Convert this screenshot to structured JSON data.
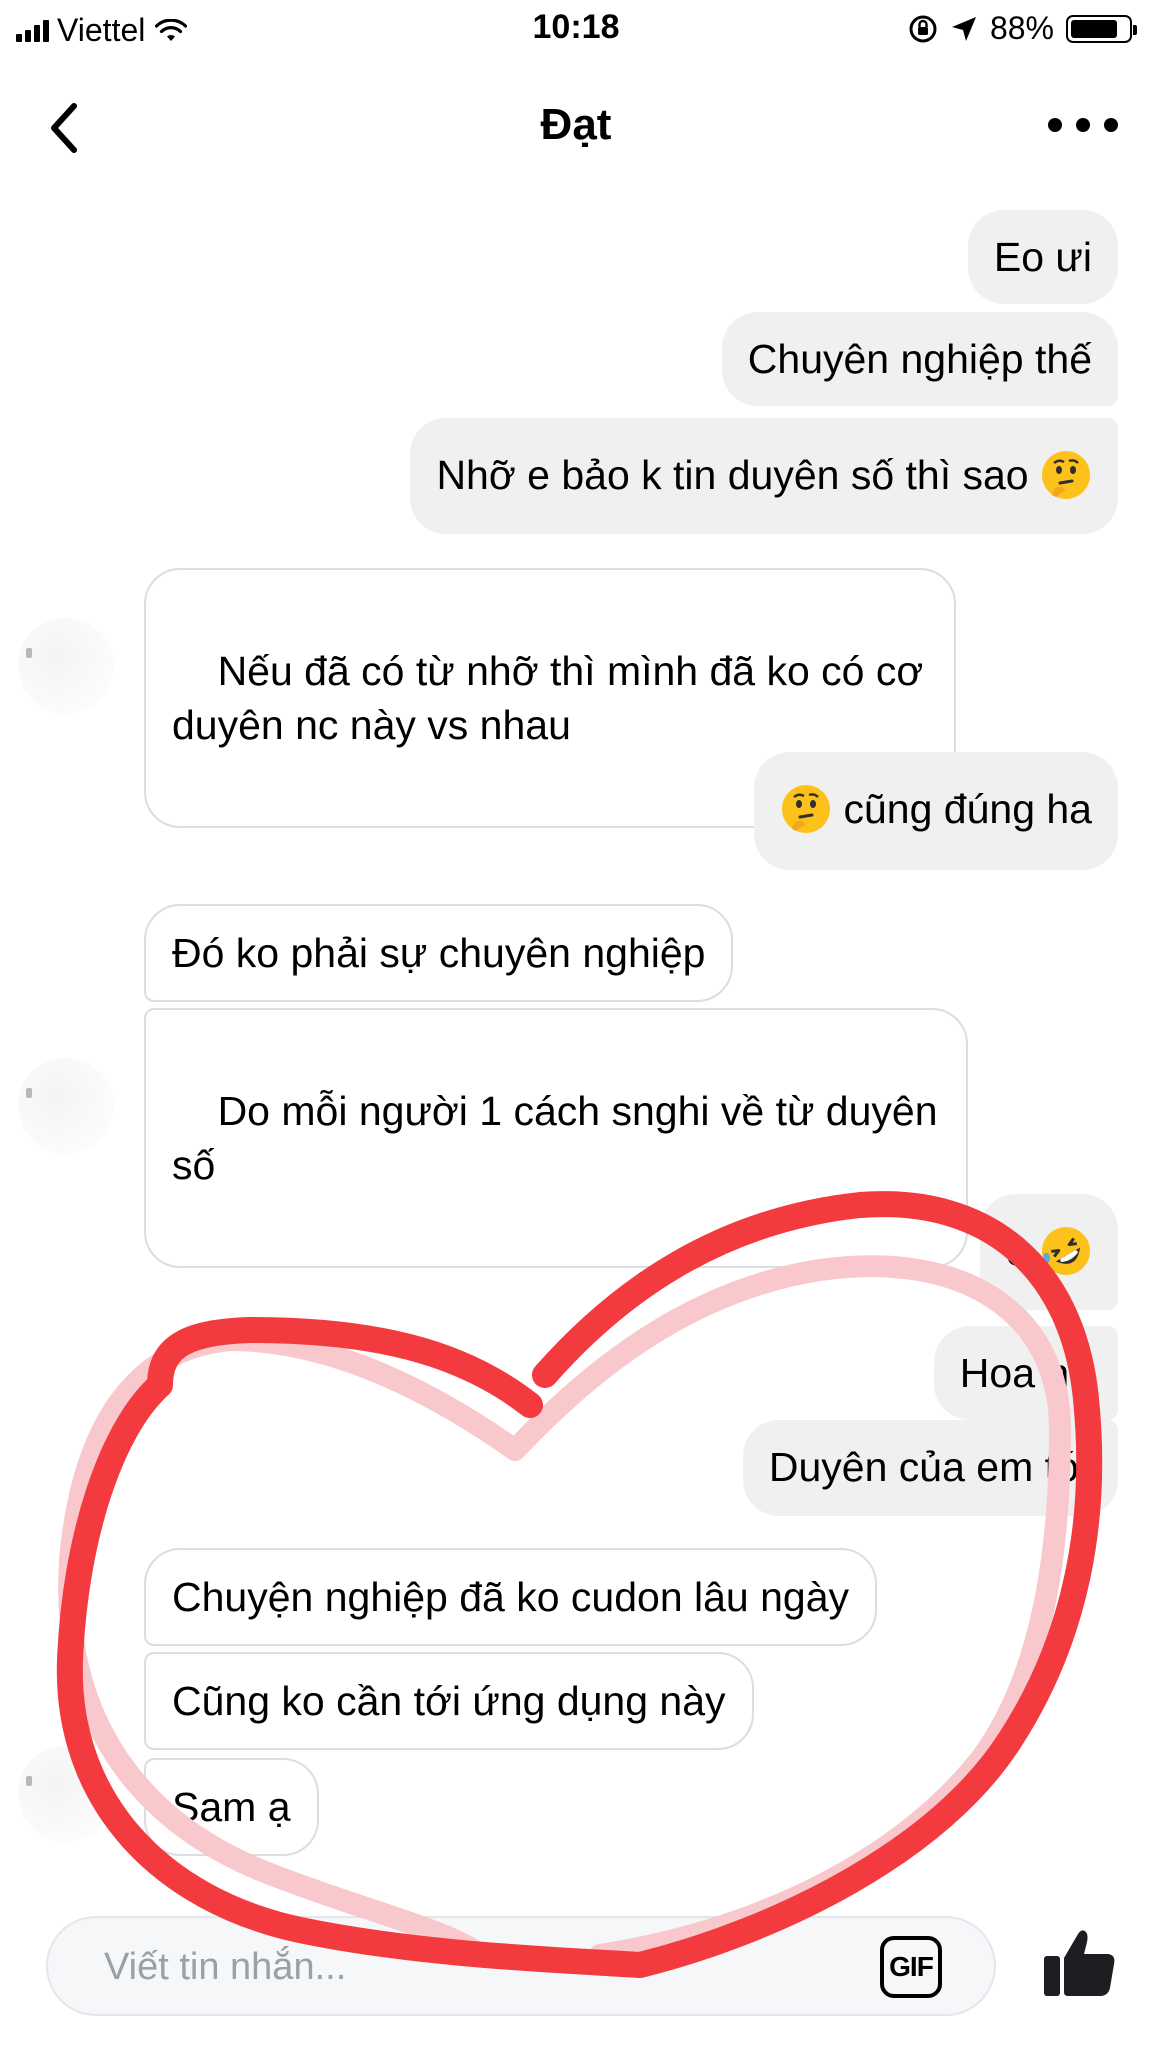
{
  "status_bar": {
    "carrier": "Viettel",
    "time": "10:18",
    "battery_percent": "88%",
    "battery_level": 0.88
  },
  "header": {
    "title": "Đạt",
    "back_icon": "chevron-left-icon",
    "more_icon": "more-dots-icon"
  },
  "messages": [
    {
      "side": "out",
      "text": "Eo ưi"
    },
    {
      "side": "out",
      "text": "Chuyên nghiệp thế"
    },
    {
      "side": "out",
      "text": "Nhỡ e bảo k tin duyên số thì sao",
      "emoji_after": "thinking-face"
    },
    {
      "side": "in",
      "text": "Nếu đã có từ nhỡ thì mình đã ko có cơ duyên nc này vs nhau"
    },
    {
      "side": "out",
      "text": "cũng đúng ha",
      "emoji_before": "thinking-face"
    },
    {
      "side": "in",
      "text": "Đó ko phải sự chuyên nghiệp"
    },
    {
      "side": "in",
      "text": "Do mỗi người 1 cách snghi về từ duyên số"
    },
    {
      "side": "out",
      "text": "ồ",
      "emoji_after": "rolling-laughing-face"
    },
    {
      "side": "out",
      "text": "Hoa ha"
    },
    {
      "side": "out",
      "text": "Duyên của em tới"
    },
    {
      "side": "in",
      "text": "Chuyện nghiệp đã ko cudon lâu ngày"
    },
    {
      "side": "in",
      "text": "Cũng ko cần tới ứng dụng này"
    },
    {
      "side": "in",
      "text": "Sam ạ"
    }
  ],
  "composer": {
    "placeholder": "Viết tin nhắn...",
    "gif_label": "GIF",
    "like_icon": "thumbs-up-icon"
  },
  "annotation": {
    "shape": "heart",
    "color": "#f23a3f",
    "shadow_color": "#f8c8cc"
  }
}
